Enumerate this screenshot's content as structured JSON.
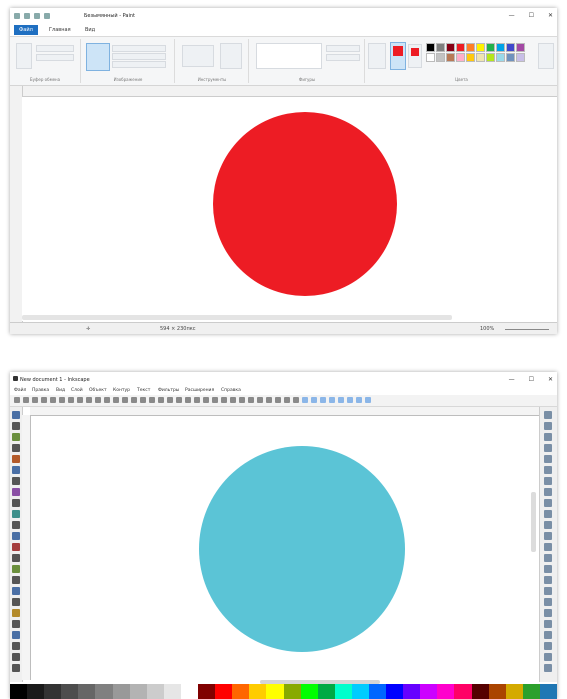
{
  "paint": {
    "title": "Безымянный - Paint",
    "tabs": [
      "Файл",
      "Главная",
      "Вид"
    ],
    "ribbon_groups": [
      "Буфер обмена",
      "Изображение",
      "Инструменты",
      "Фигуры",
      "Цвета"
    ],
    "status": {
      "size": "594 × 230пкс",
      "zoom": "100%"
    },
    "circle_color": "#ed1c24",
    "palette": [
      "#000000",
      "#7f7f7f",
      "#880015",
      "#ed1c24",
      "#ff7f27",
      "#fff200",
      "#22b14c",
      "#00a2e8",
      "#3f48cc",
      "#a349a4",
      "#ffffff",
      "#c3c3c3",
      "#b97a57",
      "#ffaec9",
      "#ffc90e",
      "#efe4b0",
      "#b5e61d",
      "#99d9ea",
      "#7092be",
      "#c8bfe7"
    ]
  },
  "inkscape": {
    "title": "New document 1 - Inkscape",
    "menu": [
      "Файл",
      "Правка",
      "Вид",
      "Слой",
      "Объект",
      "Контур",
      "Текст",
      "Фильтры",
      "Расширения",
      "Справка"
    ],
    "circle_color": "#5bc4d6",
    "palette": [
      "#000000",
      "#1a1a1a",
      "#333333",
      "#4d4d4d",
      "#666666",
      "#808080",
      "#999999",
      "#b3b3b3",
      "#cccccc",
      "#e6e6e6",
      "#ffffff",
      "#800000",
      "#ff0000",
      "#ff6600",
      "#ffcc00",
      "#ffff00",
      "#88aa00",
      "#00ff00",
      "#00aa44",
      "#00ffcc",
      "#00ccff",
      "#0066ff",
      "#0000ff",
      "#6600ff",
      "#cc00ff",
      "#ff00cc",
      "#ff0066",
      "#550000",
      "#aa4400",
      "#d4aa00",
      "#2ca02c",
      "#1f77b4"
    ]
  }
}
